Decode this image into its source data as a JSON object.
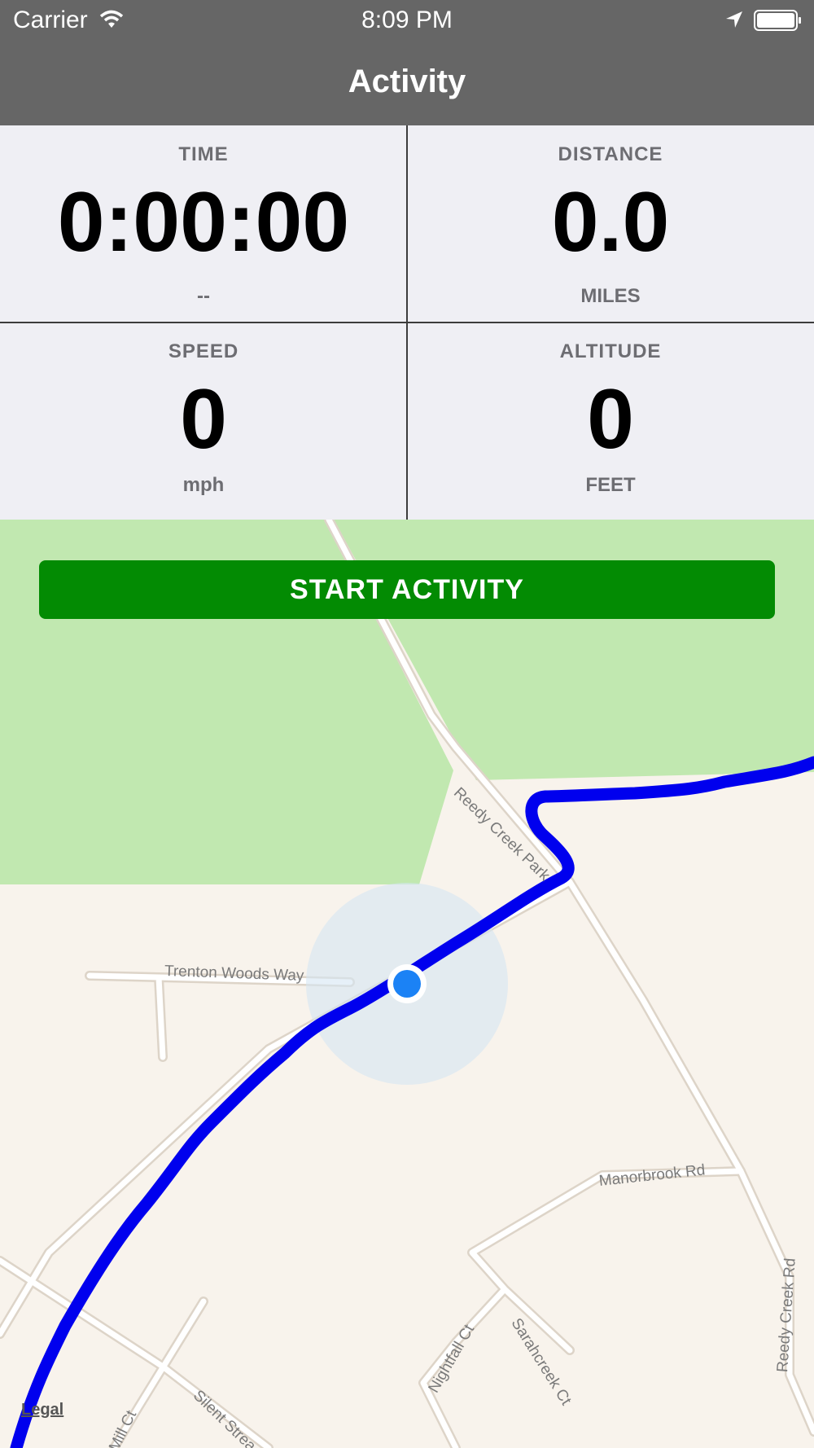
{
  "status_bar": {
    "carrier": "Carrier",
    "time": "8:09 PM",
    "icons": [
      "wifi-icon",
      "location-arrow-icon",
      "battery-icon"
    ]
  },
  "nav": {
    "title": "Activity"
  },
  "stats": {
    "time": {
      "label": "TIME",
      "value": "0:00:00",
      "unit": "--"
    },
    "distance": {
      "label": "DISTANCE",
      "value": "0.0",
      "unit": "MILES"
    },
    "speed": {
      "label": "SPEED",
      "value": "0",
      "unit": "mph"
    },
    "altitude": {
      "label": "ALTITUDE",
      "value": "0",
      "unit": "FEET"
    }
  },
  "action": {
    "start_label": "START ACTIVITY"
  },
  "map": {
    "roads": [
      "Trenton Woods Way",
      "Reedy Creek Park",
      "Manorbrook Rd",
      "Reedy Creek Rd",
      "Nightfall Ct",
      "Sarahcreek Ct",
      "Silent Strea",
      "Mill Ct"
    ],
    "legal": "Legal"
  },
  "colors": {
    "header": "#666666",
    "start_button": "#038b03",
    "route": "#0000ee",
    "user_location": "#1b82f5",
    "park": "#c1e8b0",
    "land": "#f8f3ec"
  }
}
